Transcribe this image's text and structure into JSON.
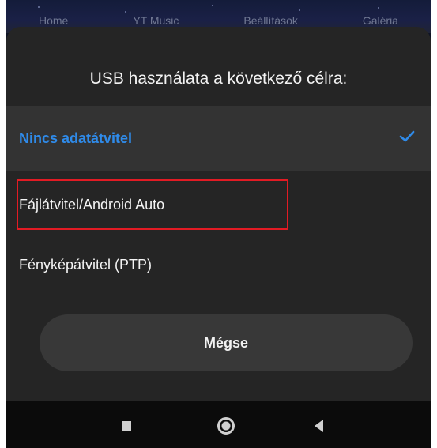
{
  "home_tabs": [
    "Home",
    "YT Music",
    "Beállítások",
    "Galéria"
  ],
  "dialog": {
    "title": "USB használata a következő célra:",
    "options": [
      {
        "label": "Nincs adatátvitel",
        "selected": true,
        "icon": "check-icon"
      },
      {
        "label": "Fájlátvitel/Android Auto",
        "selected": false,
        "highlighted": true
      },
      {
        "label": "Fényképátvitel (PTP)",
        "selected": false
      }
    ],
    "cancel_label": "Mégse"
  },
  "nav": {
    "recents": "square-icon",
    "home": "circle-icon",
    "back": "triangle-back-icon"
  },
  "colors": {
    "selected_text": "#2f8bea",
    "highlight_box": "#e21b24",
    "dialog_bg": "#252525"
  }
}
